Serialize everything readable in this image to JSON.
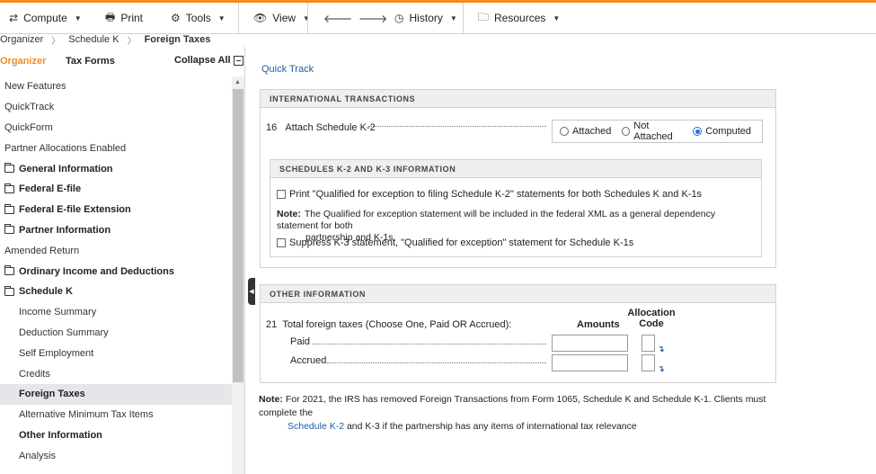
{
  "toolbar": {
    "compute": "Compute",
    "print": "Print",
    "tools": "Tools",
    "view": "View",
    "history": "History",
    "resources": "Resources",
    "accent_color": "#f58a1f"
  },
  "breadcrumb": [
    "Organizer",
    "Schedule K",
    "Foreign Taxes"
  ],
  "sidebar": {
    "tab_organizer": "Organizer",
    "tab_tax_forms": "Tax Forms",
    "collapse_all": "Collapse All",
    "items": [
      {
        "label": "New Features"
      },
      {
        "label": "QuickTrack"
      },
      {
        "label": "QuickForm"
      },
      {
        "label": "Partner Allocations Enabled"
      },
      {
        "label": "General Information"
      },
      {
        "label": "Federal E-file"
      },
      {
        "label": "Federal E-file Extension"
      },
      {
        "label": "Partner Information"
      },
      {
        "label": "Amended Return"
      },
      {
        "label": "Ordinary Income and Deductions"
      },
      {
        "label": "Schedule K"
      },
      {
        "label": "Income Summary"
      },
      {
        "label": "Deduction Summary"
      },
      {
        "label": "Self Employment"
      },
      {
        "label": "Credits"
      },
      {
        "label": "Foreign Taxes"
      },
      {
        "label": "Alternative Minimum Tax Items"
      },
      {
        "label": "Other Information"
      },
      {
        "label": "Analysis"
      }
    ]
  },
  "main": {
    "quick_track": "Quick Track",
    "international": {
      "header": "INTERNATIONAL TRANSACTIONS",
      "line16_num": "16",
      "line16_label": "Attach Schedule K-2",
      "options": [
        "Attached",
        "Not Attached",
        "Computed"
      ],
      "selected": "Computed"
    },
    "k2k3": {
      "header": "SCHEDULES K-2 AND K-3 INFORMATION",
      "print_checkbox": "Print \"Qualified for exception to filing Schedule K-2\" statements for both Schedules K and K-1s",
      "note_label": "Note:",
      "note_line1": "The Qualified for exception statement will be included in the federal XML as a general dependency statement for both",
      "note_line2": "partnership and K-1s.",
      "suppress_checkbox": "Suppress K-3 statement, \"Qualified for exception\" statement for Schedule K-1s"
    },
    "other": {
      "header": "OTHER INFORMATION",
      "line21_num": "21",
      "line21_label": "Total foreign taxes (Choose One, Paid OR Accrued):",
      "amounts_header": "Amounts",
      "allocation_header_1": "Allocation",
      "allocation_header_2": "Code",
      "paid_label": "Paid",
      "accrued_label": "Accrued",
      "paid_amount": "",
      "accrued_amount": "",
      "paid_code": "",
      "accrued_code": ""
    },
    "bottom_note": {
      "label": "Note:",
      "line1": "For 2021, the IRS has removed Foreign Transactions from Form 1065, Schedule K and Schedule K-1. Clients must complete the",
      "link": "Schedule K-2",
      "line2_rest": " and K-3 if the partnership has any items of international tax relevance"
    }
  }
}
